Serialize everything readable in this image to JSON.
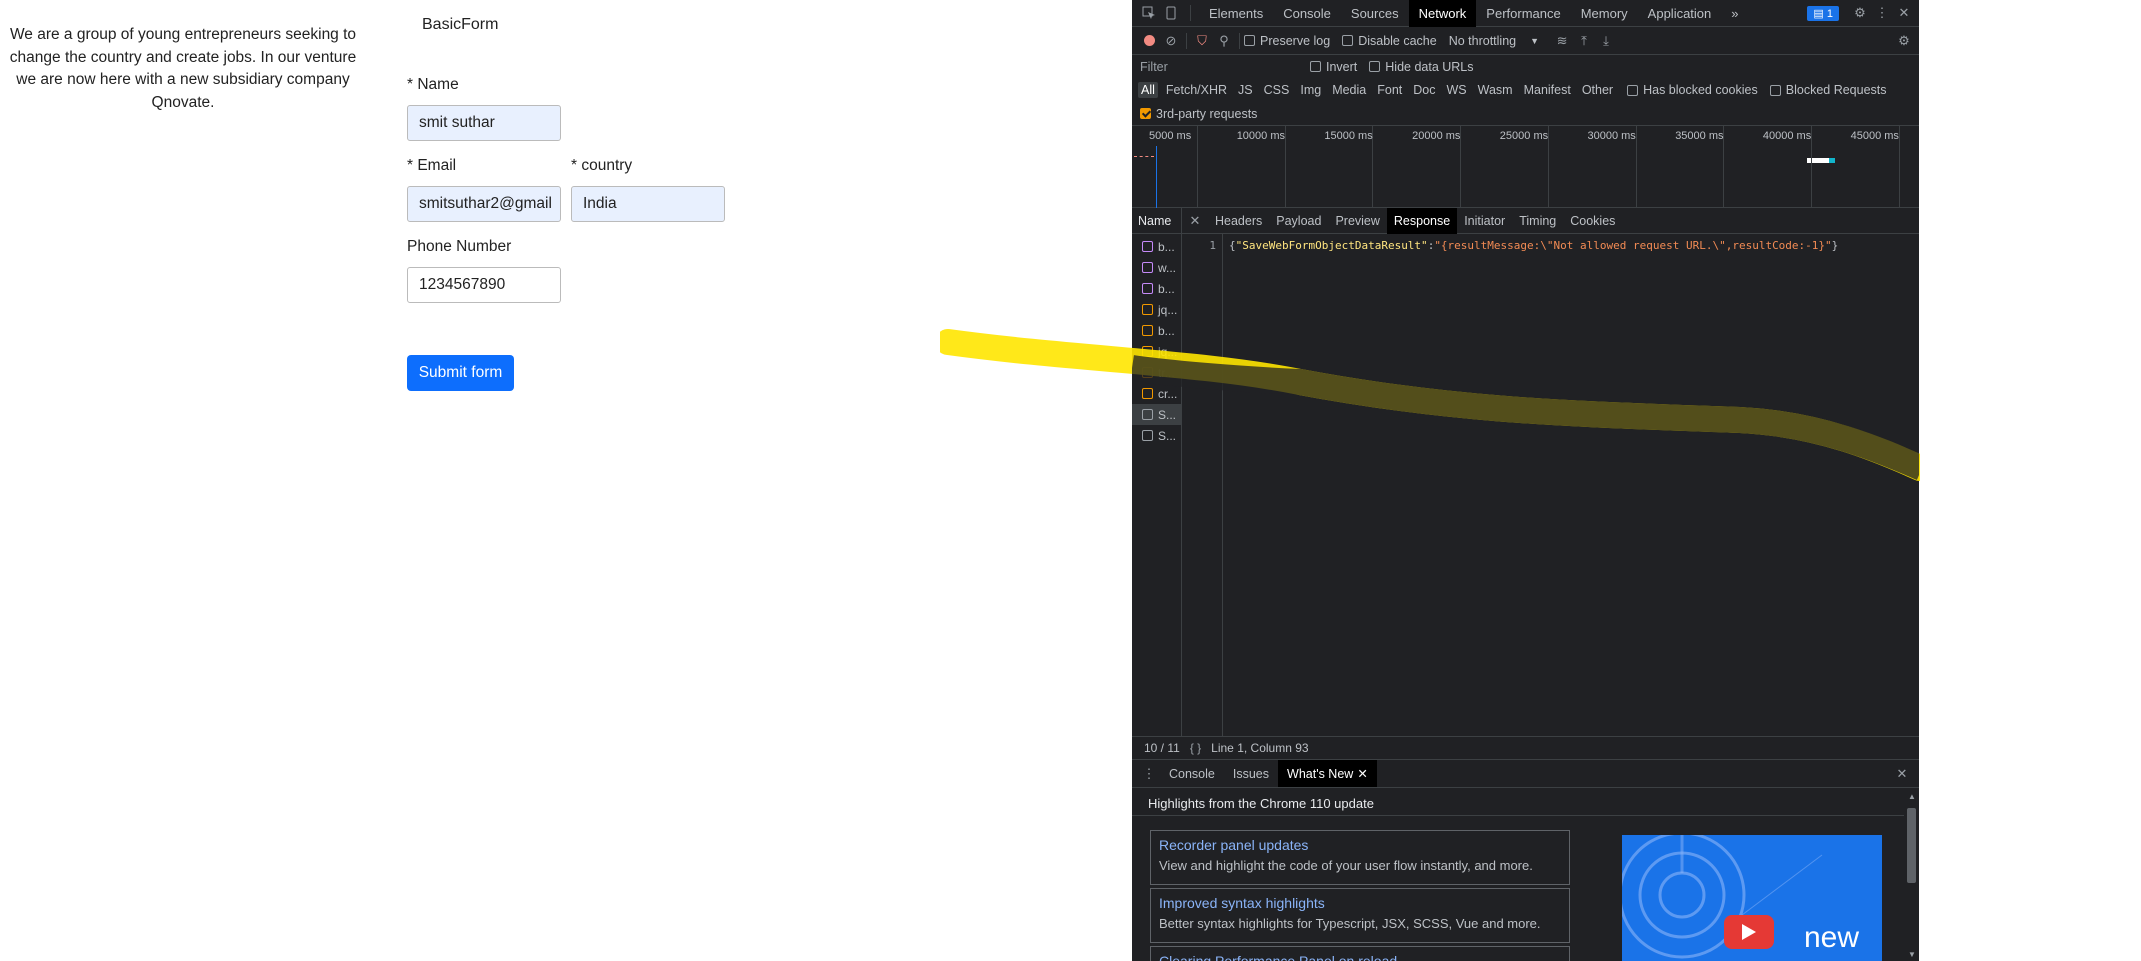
{
  "page": {
    "intro_text": "We are a group of young entrepreneurs seeking to change the country and create jobs. In our venture we are now here with a new subsidiary company Qnovate.",
    "brand": "BasicForm",
    "form": {
      "name_label": "* Name",
      "name_value": "smit suthar",
      "email_label": "* Email",
      "email_value": "smitsuthar2@gmail",
      "country_label": "* country",
      "country_value": "India",
      "phone_label": "Phone Number",
      "phone_value": "1234567890",
      "submit_label": "Submit form"
    }
  },
  "devtools": {
    "main_tabs": [
      "Elements",
      "Console",
      "Sources",
      "Network",
      "Performance",
      "Memory",
      "Application"
    ],
    "selected_main_tab": "Network",
    "more_tabs_glyph": "»",
    "issue_count": "1",
    "toolbar": {
      "preserve_log": "Preserve log",
      "disable_cache": "Disable cache",
      "throttling": "No throttling"
    },
    "filter_placeholder": "Filter",
    "invert_label": "Invert",
    "hide_data_urls": "Hide data URLs",
    "type_filters": [
      "All",
      "Fetch/XHR",
      "JS",
      "CSS",
      "Img",
      "Media",
      "Font",
      "Doc",
      "WS",
      "Wasm",
      "Manifest",
      "Other"
    ],
    "blocked_cookies": "Has blocked cookies",
    "blocked_requests": "Blocked Requests",
    "third_party": "3rd-party requests",
    "timeline_ticks": [
      "5000 ms",
      "10000 ms",
      "15000 ms",
      "20000 ms",
      "25000 ms",
      "30000 ms",
      "35000 ms",
      "40000 ms",
      "45000 ms"
    ],
    "name_header": "Name",
    "request_tabs": [
      "Headers",
      "Payload",
      "Preview",
      "Response",
      "Initiator",
      "Timing",
      "Cookies"
    ],
    "selected_request_tab": "Response",
    "requests": [
      {
        "name": "b...",
        "color": "#c58af9"
      },
      {
        "name": "w...",
        "color": "#c58af9"
      },
      {
        "name": "b...",
        "color": "#c58af9"
      },
      {
        "name": "jq...",
        "color": "#f29900"
      },
      {
        "name": "b...",
        "color": "#f29900"
      },
      {
        "name": "jq...",
        "color": "#f29900"
      },
      {
        "name": "tr...",
        "color": "#f29900"
      },
      {
        "name": "cr...",
        "color": "#f29900"
      },
      {
        "name": "S...",
        "color": "#9aa0a6"
      },
      {
        "name": "S...",
        "color": "#9aa0a6"
      }
    ],
    "response": {
      "line_number": "1",
      "key": "\"SaveWebFormObjectDataResult\"",
      "value": "\"{resultMessage:\\\"Not allowed request URL.\\\",resultCode:-1}\""
    },
    "status": {
      "count": "10 / 11",
      "braces": "{ }",
      "position": "Line 1, Column 93"
    },
    "drawer_tabs": [
      "Console",
      "Issues",
      "What's New"
    ],
    "selected_drawer_tab": "What's New",
    "whats_new": {
      "heading": "Highlights from the Chrome 110 update",
      "cards": [
        {
          "title": "Recorder panel updates",
          "desc": "View and highlight the code of your user flow instantly, and more."
        },
        {
          "title": "Improved syntax highlights",
          "desc": "Better syntax highlights for Typescript, JSX, SCSS, Vue and more."
        },
        {
          "title": "Clearing Performance Panel on reload",
          "desc": ""
        }
      ],
      "thumb_text": "new"
    },
    "colors": {
      "bg": "#202124",
      "accent": "#1a73e8",
      "link": "#8ab4f8",
      "json_key": "#ffe57f",
      "json_string": "#f28b54"
    }
  }
}
